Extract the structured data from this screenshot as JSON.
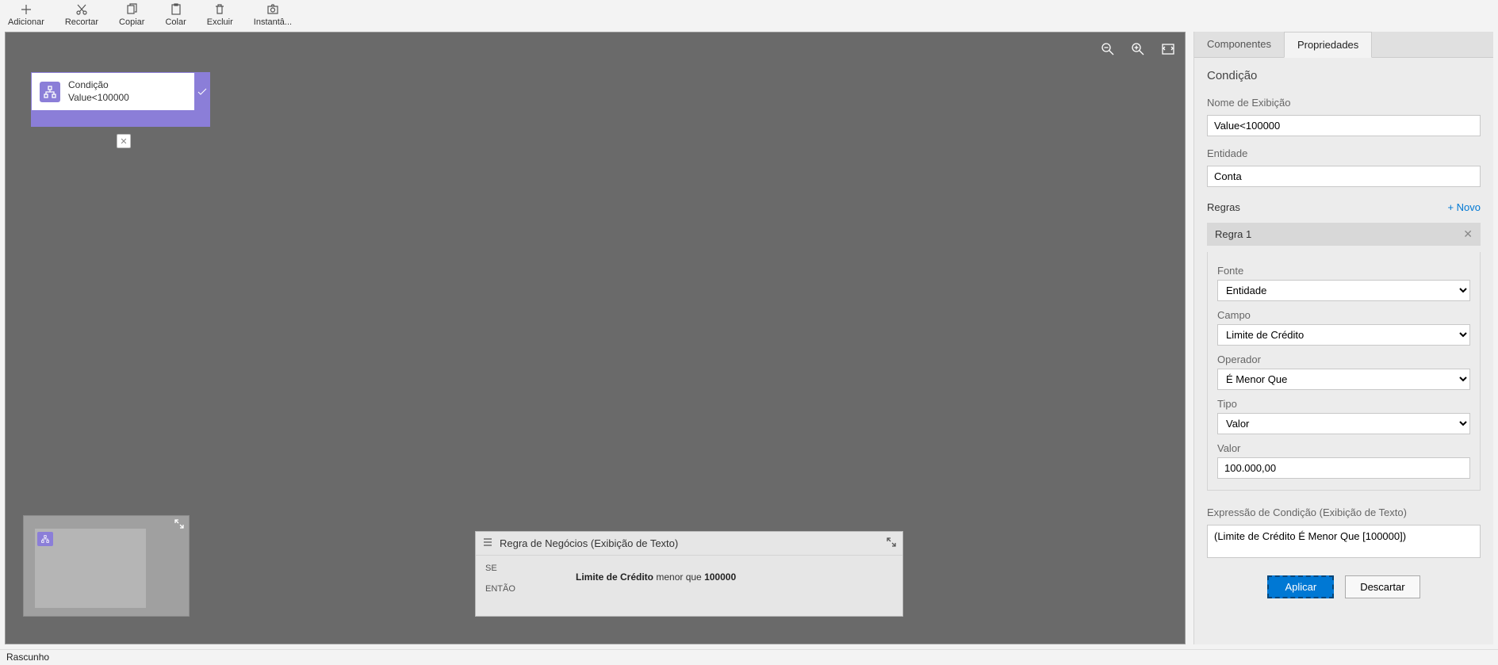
{
  "toolbar": {
    "add": "Adicionar",
    "cut": "Recortar",
    "copy": "Copiar",
    "paste": "Colar",
    "delete": "Excluir",
    "snapshot": "Instantâ..."
  },
  "canvas": {
    "node": {
      "title": "Condição",
      "subtitle": "Value<100000"
    }
  },
  "business_rule_panel": {
    "title": "Regra de Negócios (Exibição de Texto)",
    "if_label": "SE",
    "then_label": "ENTÃO",
    "clause_field": "Limite de Crédito",
    "clause_operator": "menor que",
    "clause_value": "100000"
  },
  "right_panel": {
    "tab_components": "Componentes",
    "tab_properties": "Propriedades",
    "heading": "Condição",
    "display_name_label": "Nome de Exibição",
    "display_name_value": "Value<100000",
    "entity_label": "Entidade",
    "entity_value": "Conta",
    "rules_label": "Regras",
    "new_link": "+ Novo",
    "rule_title": "Regra 1",
    "source_label": "Fonte",
    "source_value": "Entidade",
    "field_label": "Campo",
    "field_value": "Limite de Crédito",
    "operator_label": "Operador",
    "operator_value": "É Menor Que",
    "type_label": "Tipo",
    "type_value": "Valor",
    "value_label": "Valor",
    "value_value": "100.000,00",
    "expression_label": "Expressão de Condição (Exibição de Texto)",
    "expression_value": "(Limite de Crédito É Menor Que [100000])",
    "apply": "Aplicar",
    "discard": "Descartar"
  },
  "status": "Rascunho"
}
